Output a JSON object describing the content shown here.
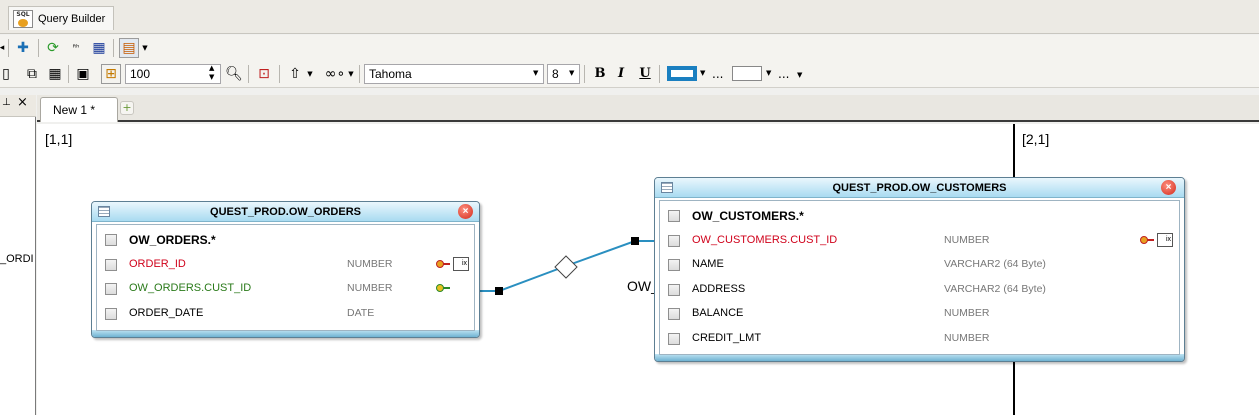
{
  "window": {
    "tab_title": "Query Builder",
    "sql_icon_text": "SQL"
  },
  "toolbar": {
    "zoom_value": "100",
    "font_name": "Tahoma",
    "font_size": "8",
    "bold_label": "B",
    "italic_label": "I",
    "underline_label": "U",
    "ellipsis": "..."
  },
  "left_panel": {
    "pin": "⊥",
    "close": "×",
    "clipped_text": "_ORDI"
  },
  "editor": {
    "tabs": [
      {
        "label": "New 1 *"
      }
    ],
    "add_tab": "+"
  },
  "canvas": {
    "cell_1": "[1,1]",
    "cell_2": "[2,1]",
    "join_label": "OW_",
    "tables": [
      {
        "title": "QUEST_PROD.OW_ORDERS",
        "columns": [
          {
            "name": "OW_ORDERS.*",
            "type": "",
            "style": "bold"
          },
          {
            "name": "ORDER_ID",
            "type": "NUMBER",
            "style": "red"
          },
          {
            "name": "OW_ORDERS.CUST_ID",
            "type": "NUMBER",
            "style": "green"
          },
          {
            "name": "ORDER_DATE",
            "type": "DATE",
            "style": "normal"
          }
        ]
      },
      {
        "title": "QUEST_PROD.OW_CUSTOMERS",
        "columns": [
          {
            "name": "OW_CUSTOMERS.*",
            "type": "",
            "style": "bold"
          },
          {
            "name": "OW_CUSTOMERS.CUST_ID",
            "type": "NUMBER",
            "style": "red"
          },
          {
            "name": "NAME",
            "type": "VARCHAR2 (64 Byte)",
            "style": "normal"
          },
          {
            "name": "ADDRESS",
            "type": "VARCHAR2 (64 Byte)",
            "style": "normal"
          },
          {
            "name": "BALANCE",
            "type": "NUMBER",
            "style": "normal"
          },
          {
            "name": "CREDIT_LMT",
            "type": "NUMBER",
            "style": "normal"
          }
        ]
      }
    ]
  },
  "colors": {
    "primary_key": "#d0021b",
    "foreign_key": "#2a7a1a",
    "join_line": "#2a8fc0",
    "table_header": "#a9dbf1"
  }
}
